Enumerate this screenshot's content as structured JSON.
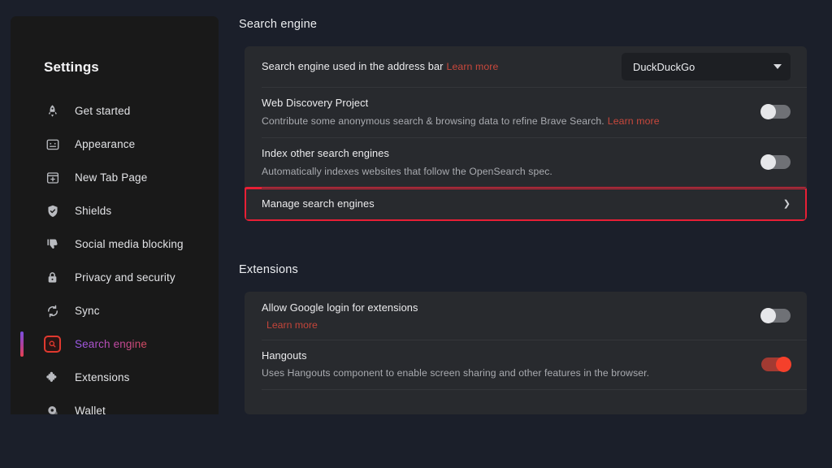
{
  "sidebar": {
    "title": "Settings",
    "items": [
      {
        "label": "Get started",
        "icon": "rocket-icon",
        "name": "get-started",
        "active": false
      },
      {
        "label": "Appearance",
        "icon": "appearance-icon",
        "name": "appearance",
        "active": false
      },
      {
        "label": "New Tab Page",
        "icon": "new-tab-icon",
        "name": "new-tab-page",
        "active": false
      },
      {
        "label": "Shields",
        "icon": "shield-check-icon",
        "name": "shields",
        "active": false
      },
      {
        "label": "Social media blocking",
        "icon": "thumbs-down-icon",
        "name": "social-media-blocking",
        "active": false
      },
      {
        "label": "Privacy and security",
        "icon": "lock-icon",
        "name": "privacy-and-security",
        "active": false
      },
      {
        "label": "Sync",
        "icon": "sync-icon",
        "name": "sync",
        "active": false
      },
      {
        "label": "Search engine",
        "icon": "search-box-icon",
        "name": "search-engine",
        "active": true
      },
      {
        "label": "Extensions",
        "icon": "puzzle-icon",
        "name": "extensions",
        "active": false
      },
      {
        "label": "Wallet",
        "icon": "wallet-icon",
        "name": "wallet",
        "active": false
      }
    ]
  },
  "main": {
    "search_section": {
      "title": "Search engine",
      "address_bar_row": {
        "title": "Search engine used in the address bar",
        "learn_more": "Learn more",
        "select_value": "DuckDuckGo"
      },
      "web_discovery_row": {
        "title": "Web Discovery Project",
        "subtitle": "Contribute some anonymous search & browsing data to refine Brave Search.",
        "learn_more": "Learn more",
        "toggle_state": "off"
      },
      "index_other_row": {
        "title": "Index other search engines",
        "subtitle": "Automatically indexes websites that follow the OpenSearch spec.",
        "toggle_state": "off"
      },
      "manage_row": {
        "title": "Manage search engines",
        "chevron": "❯",
        "highlighted": true
      }
    },
    "extensions_section": {
      "title": "Extensions",
      "google_login_row": {
        "title": "Allow Google login for extensions",
        "learn_more": "Learn more",
        "toggle_state": "off"
      },
      "hangouts_row": {
        "title": "Hangouts",
        "subtitle": "Uses Hangouts component to enable screen sharing and other features in the browser.",
        "toggle_state": "on"
      }
    }
  },
  "colors": {
    "page_background": "#1b1f2a",
    "sidebar_background": "#191919",
    "card_background": "#282a2e",
    "accent_link": "#c9483c",
    "highlight_border": "#e81f35",
    "toggle_on": "#f5402b",
    "active_gradient_start": "#7b4fe0",
    "active_gradient_end": "#e8414f"
  }
}
